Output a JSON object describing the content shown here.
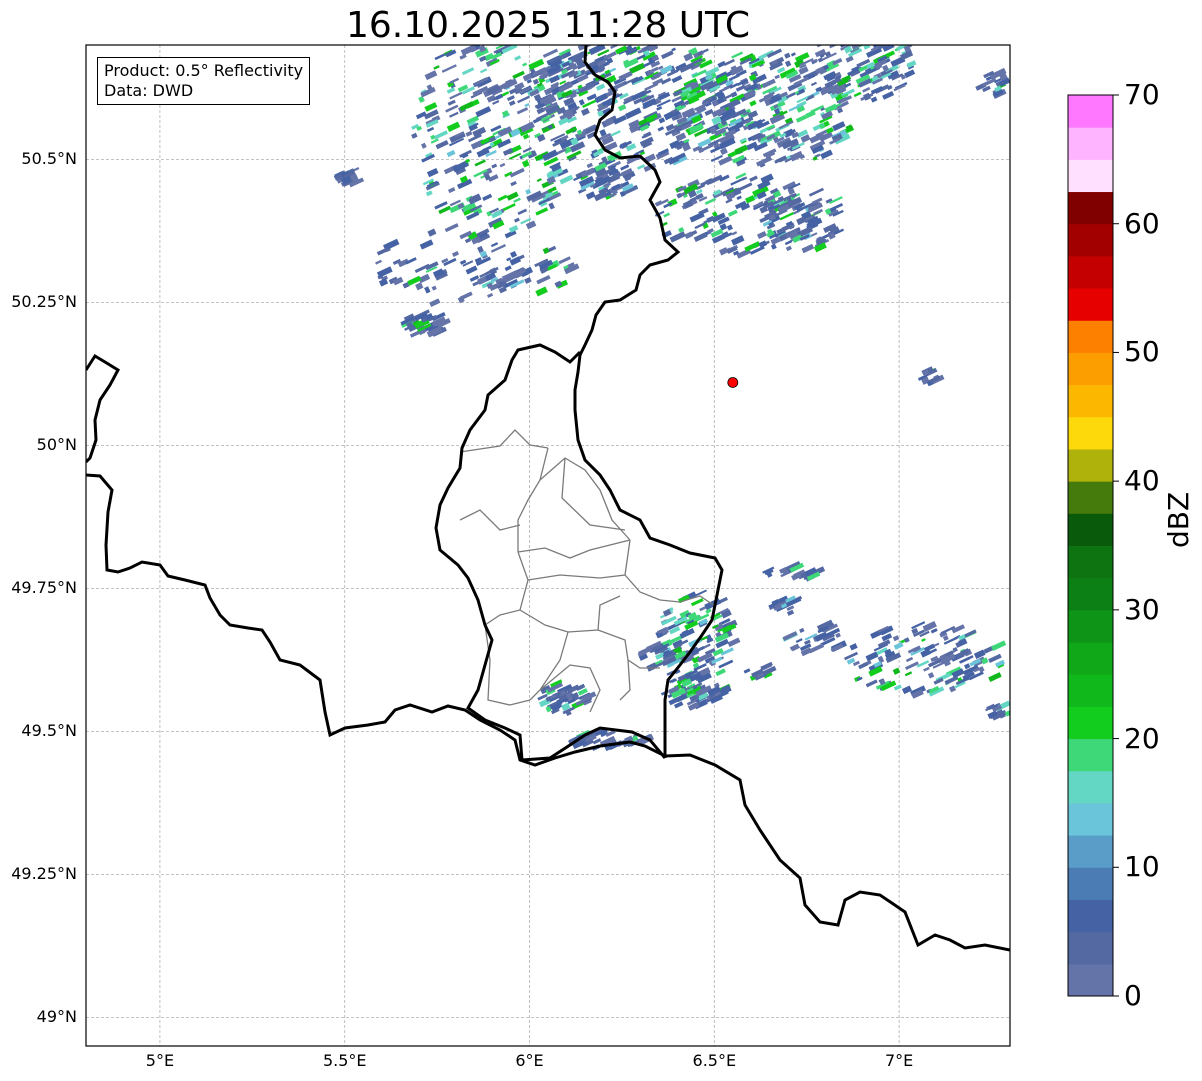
{
  "title": "16.10.2025 11:28 UTC",
  "info_box": {
    "product": "Product: 0.5° Reflectivity",
    "data": "Data: DWD"
  },
  "map": {
    "lon_range": [
      4.8,
      7.3
    ],
    "lat_range": [
      48.95,
      50.7
    ],
    "lat_ticks": [
      {
        "value": 50.5,
        "label": "50.5°N"
      },
      {
        "value": 50.25,
        "label": "50.25°N"
      },
      {
        "value": 50.0,
        "label": "50°N"
      },
      {
        "value": 49.75,
        "label": "49.75°N"
      },
      {
        "value": 49.5,
        "label": "49.5°N"
      },
      {
        "value": 49.25,
        "label": "49.25°N"
      },
      {
        "value": 49.0,
        "label": "49°N"
      }
    ],
    "lon_ticks": [
      {
        "value": 5.0,
        "label": "5°E"
      },
      {
        "value": 5.5,
        "label": "5.5°E"
      },
      {
        "value": 6.0,
        "label": "6°E"
      },
      {
        "value": 6.5,
        "label": "6.5°E"
      },
      {
        "value": 7.0,
        "label": "7°E"
      }
    ],
    "grid": true,
    "radar_site": {
      "lon": 6.55,
      "lat": 50.11,
      "color": "#ff0000"
    }
  },
  "colorbar": {
    "label": "dBZ",
    "min": 0,
    "max": 70,
    "step": 2.5,
    "ticks": [
      "0",
      "10",
      "20",
      "30",
      "40",
      "50",
      "60",
      "70"
    ],
    "colors": [
      "#6473a8",
      "#5468a2",
      "#4462a4",
      "#4b7cb4",
      "#5a9dc8",
      "#6ac4da",
      "#64d6c4",
      "#3ed878",
      "#12cc1e",
      "#10b81c",
      "#10a818",
      "#0e9416",
      "#0c8014",
      "#0e7412",
      "#0a5a0c",
      "#457a0c",
      "#afb20a",
      "#fdd80b",
      "#fcb800",
      "#fd9e00",
      "#fd8000",
      "#e60000",
      "#c40000",
      "#a20000",
      "#800000",
      "#ffe0ff",
      "#ffb4ff",
      "#ff78ff",
      "#f03cf0"
    ]
  }
}
